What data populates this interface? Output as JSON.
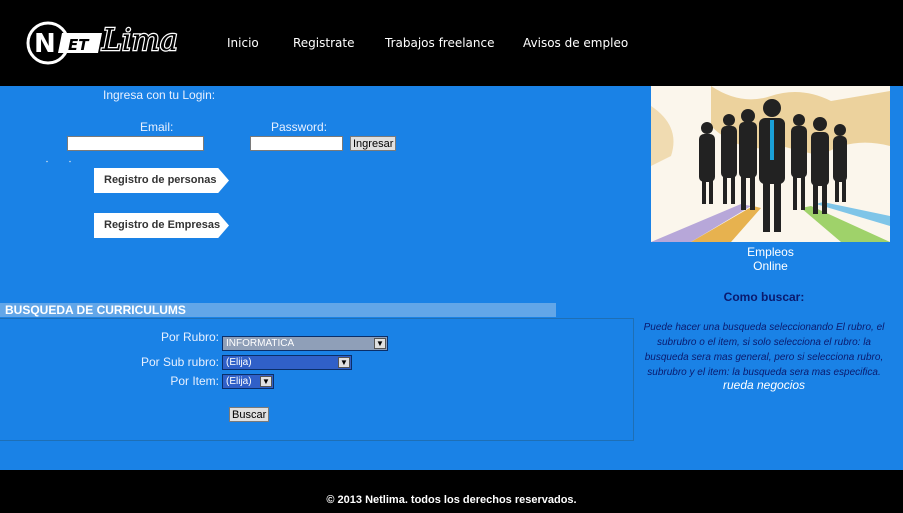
{
  "header": {
    "logo_text": "NetLima",
    "nav": [
      {
        "label": "Inicio"
      },
      {
        "label": "Registrate"
      },
      {
        "label": "Trabajos freelance"
      },
      {
        "label": "Avisos de empleo"
      }
    ]
  },
  "login": {
    "title": "Ingresa con tu Login:",
    "email_label": "Email:",
    "password_label": "Password:",
    "email_value": "",
    "password_value": "",
    "submit_label": "Ingresar"
  },
  "register": {
    "personas_label": "Registro de personas",
    "empresas_label": "Registro de Empresas"
  },
  "search": {
    "title": "BUSQUEDA DE CURRICULUMS",
    "rubro_label": "Por Rubro:",
    "rubro_value": "INFORMATICA",
    "subrubro_label": "Por Sub rubro:",
    "subrubro_value": "(Elija)",
    "item_label": "Por Item:",
    "item_value": "(Elija)",
    "submit_label": "Buscar"
  },
  "sidebar": {
    "caption_line1": "Empleos",
    "caption_line2": "Online",
    "how_title": "Como buscar:",
    "how_text": "Puede hacer una busqueda seleccionando El rubro, el subrubro o el item, si solo selecciona el rubro: la busqueda sera mas general, pero si selecciona rubro, subrubro y el item: la busqueda sera mas especifica.",
    "link_text": "rueda negocios"
  },
  "footer": {
    "copyright": "© 2013 Netlima. todos los derechos reservados."
  },
  "colors": {
    "page_bg": "#1a82e6",
    "header_bg": "#000000",
    "search_title_bg": "#62a6e8",
    "select_bg": "#3060c8",
    "help_text": "#0a1a6e"
  }
}
